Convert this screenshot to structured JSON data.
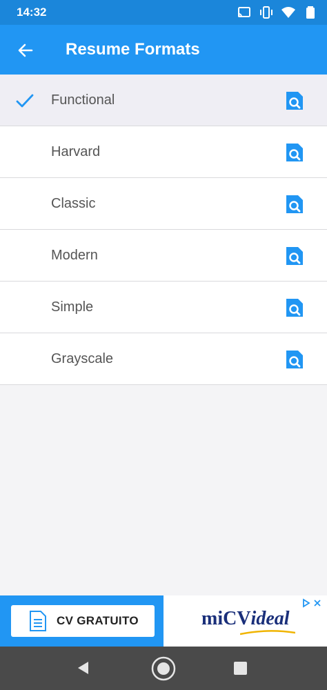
{
  "status_bar": {
    "time": "14:32",
    "icons": [
      "cast-icon",
      "vibrate-icon",
      "wifi-icon",
      "battery-icon"
    ]
  },
  "app_bar": {
    "title": "Resume Formats",
    "back_icon": "arrow-left-icon"
  },
  "formats": [
    {
      "label": "Functional",
      "selected": true
    },
    {
      "label": "Harvard",
      "selected": false
    },
    {
      "label": "Classic",
      "selected": false
    },
    {
      "label": "Modern",
      "selected": false
    },
    {
      "label": "Simple",
      "selected": false
    },
    {
      "label": "Grayscale",
      "selected": false
    }
  ],
  "ad": {
    "button_label": "CV GRATUITO",
    "brand_prefix": "miCV",
    "brand_suffix": "ideal"
  },
  "colors": {
    "primary": "#2196f3",
    "status_bar": "#1b86da",
    "nav_bar": "#4a4a4a"
  }
}
